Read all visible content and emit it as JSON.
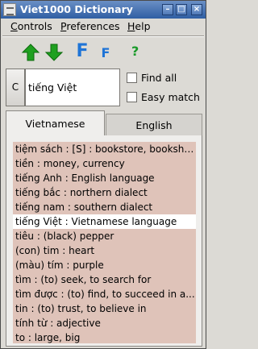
{
  "window": {
    "title": "Viet1000 Dictionary",
    "controls": [
      "minimize-icon",
      "maximize-icon",
      "close-icon"
    ]
  },
  "menu": [
    {
      "mnemonic": "C",
      "rest": "ontrols"
    },
    {
      "mnemonic": "P",
      "rest": "references"
    },
    {
      "mnemonic": "H",
      "rest": "elp"
    }
  ],
  "toolbar": {
    "icons": [
      "arrow-up-green-icon",
      "arrow-down-green-icon",
      "font-large-icon",
      "font-small-icon",
      "help-icon"
    ],
    "font_large_glyph": "F",
    "font_small_glyph": "F",
    "help_glyph": "?",
    "colors": {
      "green": "#1fa020",
      "blue": "#1f74d6"
    }
  },
  "search": {
    "clear_label": "C",
    "value": "tiếng Việt",
    "find_all_label": "Find all",
    "easy_match_label": "Easy match",
    "find_all_checked": false,
    "easy_match_checked": false
  },
  "tabs": {
    "vietnamese": "Vietnamese",
    "english": "English"
  },
  "entries": [
    "tiệm sách : [S] : bookstore, bookshop",
    "tiền : money, currency",
    "tiếng Anh : English language",
    "tiếng bắc : northern dialect",
    "tiếng nam : southern dialect",
    "tiếng Việt : Vietnamese language",
    "tiêu : (black) pepper",
    "(con) tim : heart",
    "(màu) tím : purple",
    "tìm : (to) seek, to search for",
    "tìm được : (to) find, to succeed in a...",
    "tin : (to) trust, to believe in",
    "tính từ : adjective",
    "to : large, big"
  ],
  "selected_index": 5,
  "colors": {
    "list_bg": "#dfc3b9",
    "selected_bg": "#ffffff",
    "titlebar": "#3a67ab"
  }
}
